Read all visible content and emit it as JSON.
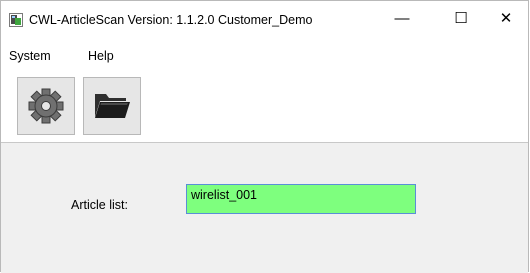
{
  "window": {
    "title": "CWL-ArticleScan  Version: 1.1.2.0  Customer_Demo",
    "minimize_glyph": "—",
    "maximize_glyph": "☐",
    "close_glyph": "✕"
  },
  "menu": {
    "items": [
      "System",
      "Help"
    ]
  },
  "toolbar": {
    "buttons": [
      {
        "icon": "gear-icon"
      },
      {
        "icon": "folder-open-icon"
      }
    ]
  },
  "main": {
    "article_list_label": "Article list:",
    "article_list_value": "wirelist_001",
    "article_list_bg": "#7eff7e"
  }
}
